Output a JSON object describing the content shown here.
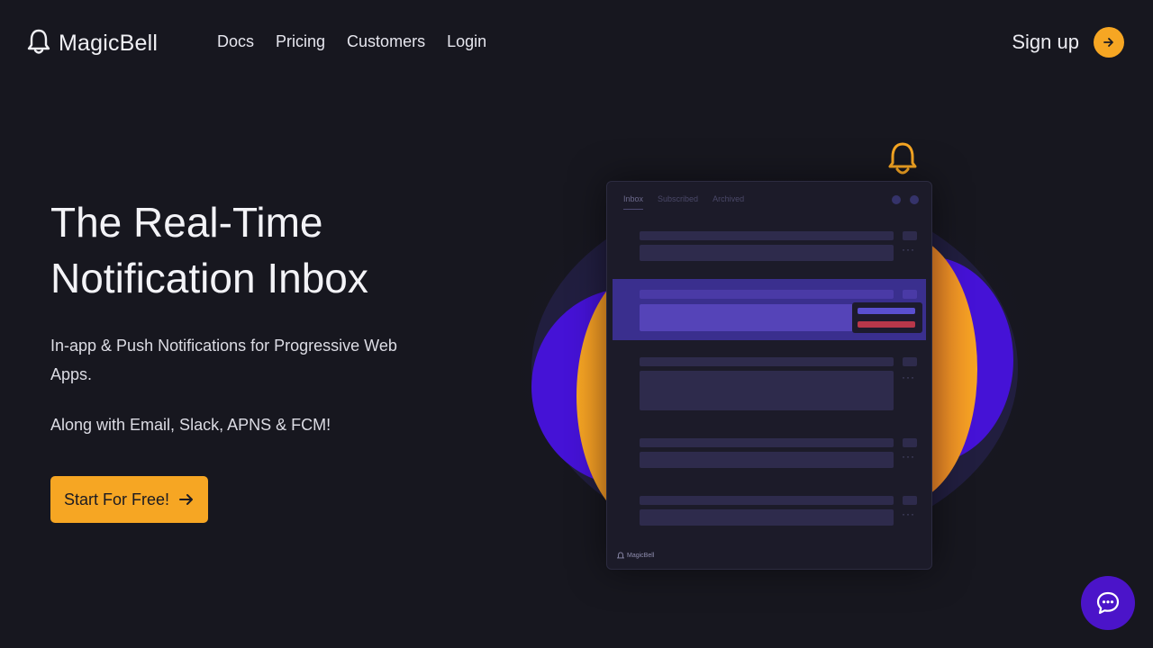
{
  "brand": {
    "name": "MagicBell"
  },
  "nav": {
    "links": [
      "Docs",
      "Pricing",
      "Customers",
      "Login"
    ],
    "signup_label": "Sign up"
  },
  "hero": {
    "title_line1": "The Real-Time",
    "title_line2": "Notification Inbox",
    "subtitle": "In-app & Push Notifications for Progressive Web Apps.",
    "subtitle2": "Along with Email, Slack, APNS & FCM!",
    "cta_label": "Start For Free!"
  },
  "inbox_preview": {
    "tabs": [
      "Inbox",
      "Subscribed",
      "Archived"
    ],
    "footer_brand": "MagicBell"
  },
  "colors": {
    "background": "#17171f",
    "accent": "#f6a623",
    "purple": "#4b14c9"
  }
}
